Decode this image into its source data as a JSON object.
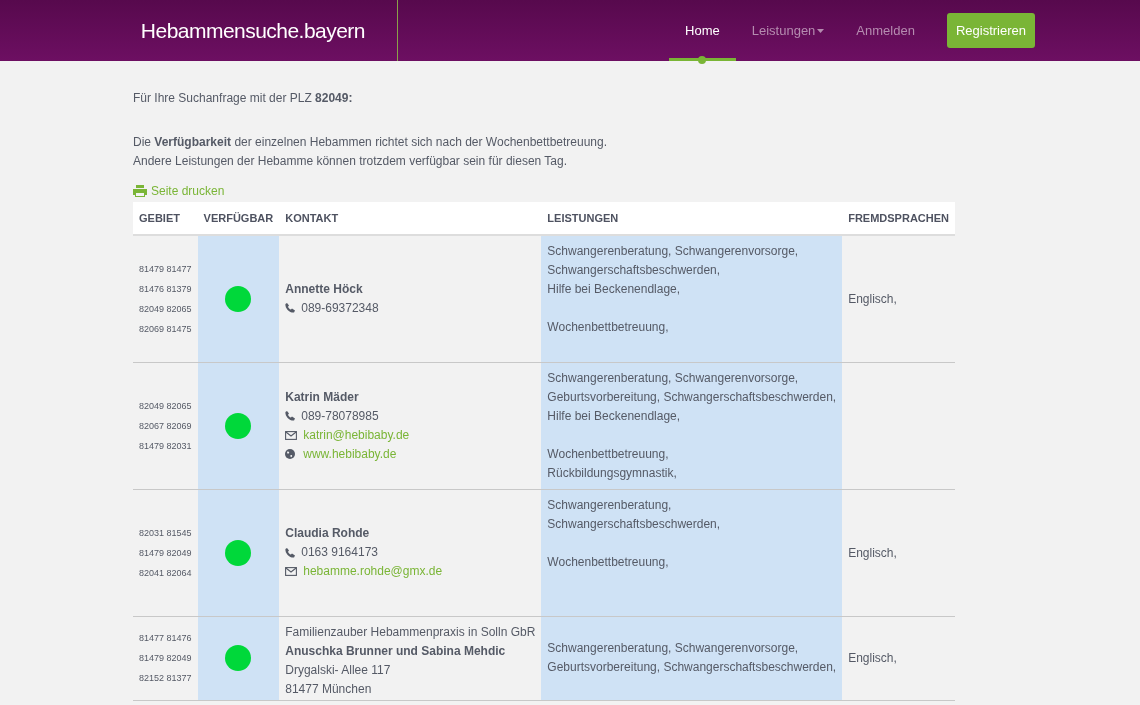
{
  "header": {
    "logo": "Hebammensuche.bayern",
    "nav": [
      {
        "label": "Home",
        "selected": true,
        "kind": "link"
      },
      {
        "label": "Leistungen",
        "selected": false,
        "kind": "dropdown"
      },
      {
        "label": "Anmelden",
        "selected": false,
        "kind": "link"
      },
      {
        "label": "Registrieren",
        "selected": false,
        "kind": "button"
      }
    ]
  },
  "intro": "Für Ihre Suchanfrage mit der PLZ **82049:**",
  "notes": [
    "Die **Verfügbarkeit** der einzelnen Hebammen richtet sich nach der Wochenbettbetreuung.",
    "Andere Leistungen der Hebamme können trotzdem verfügbar sein für diesen Tag."
  ],
  "print_link": "Seite drucken",
  "table": {
    "columns": [
      "GEBIET",
      "VERFÜGBAR",
      "KONTAKT",
      "LEISTUNGEN",
      "FREMDSPRACHEN"
    ],
    "rows": [
      {
        "area": [
          "81479 81477",
          "81476 81379",
          "82049 82065",
          "82069 81475"
        ],
        "available": true,
        "contact": [
          {
            "kind": "name",
            "text": "Annette Höck"
          },
          {
            "kind": "phone",
            "text": "089-69372348"
          }
        ],
        "services": [
          [
            "Schwangerenberatung, Schwangerenvorsorge,",
            "Schwangerschaftsbeschwerden,",
            "Hilfe bei Beckenendlage,"
          ],
          [
            "Wochenbettbetreuung,"
          ]
        ],
        "languages": "Englisch,"
      },
      {
        "area": [
          "82049 82065",
          "82067 82069",
          "81479 82031"
        ],
        "available": true,
        "contact": [
          {
            "kind": "name",
            "text": "Katrin Mäder"
          },
          {
            "kind": "phone",
            "text": "089-78078985"
          },
          {
            "kind": "email",
            "text": "katrin@hebibaby.de"
          },
          {
            "kind": "web",
            "text": "www.hebibaby.de"
          }
        ],
        "services": [
          [
            "Schwangerenberatung, Schwangerenvorsorge,",
            "Geburtsvorbereitung, Schwangerschaftsbeschwerden,",
            "Hilfe bei Beckenendlage,"
          ],
          [
            "Wochenbettbetreuung,",
            "Rückbildungsgymnastik,"
          ]
        ]
      },
      {
        "area": [
          "82031 81545",
          "81479 82049",
          "82041 82064"
        ],
        "available": true,
        "contact": [
          {
            "kind": "name",
            "text": "Claudia Rohde"
          },
          {
            "kind": "phone",
            "text": "0163 9164173"
          },
          {
            "kind": "email",
            "text": "hebamme.rohde@gmx.de"
          }
        ],
        "services": [
          [
            "Schwangerenberatung,",
            "Schwangerschaftsbeschwerden,"
          ],
          [
            "Wochenbettbetreuung,"
          ]
        ],
        "languages": "Englisch,"
      },
      {
        "area": [
          "81477 81476",
          "81479 82049",
          "82152 81377"
        ],
        "available": true,
        "contact": [
          {
            "kind": "company",
            "text": "Familienzauber Hebammenpraxis in Solln GbR"
          },
          {
            "kind": "name",
            "text": "Anuschka Brunner und Sabina Mehdic"
          },
          {
            "kind": "address",
            "text": "Drygalski- Allee 117"
          },
          {
            "kind": "address",
            "text": "81477 München"
          }
        ],
        "services": [
          [
            "Schwangerenberatung, Schwangerenvorsorge,",
            "Geburtsvorbereitung, Schwangerschaftsbeschwerden,"
          ]
        ],
        "languages": "Englisch,"
      }
    ]
  }
}
